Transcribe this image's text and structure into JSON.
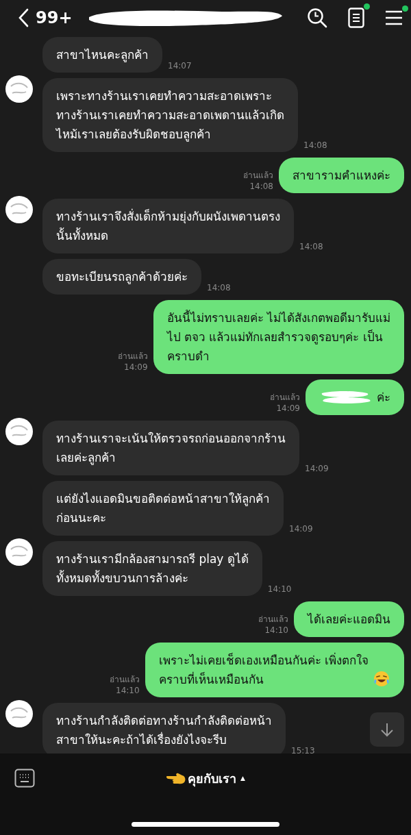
{
  "header": {
    "unread_count": "99+",
    "notes_badge": true,
    "menu_badge": true
  },
  "messages": [
    {
      "outgoing": false,
      "avatar": false,
      "kind": "text",
      "text": "สาขาไหนคะลูกค้า",
      "time": "14:07"
    },
    {
      "outgoing": false,
      "avatar": true,
      "kind": "text",
      "text": "เพราะทางร้านเราเคยทำความสะอาดเพราะ\nทางร้านเราเคยทำความสะอาดเพดานแล้วเกิด\nไหม้เราเลยต้องรับผิดชอบลูกค้า",
      "time": "14:08"
    },
    {
      "outgoing": true,
      "read": "อ่านแล้ว",
      "kind": "text",
      "text": "สาขารามคำแหงค่ะ",
      "time": "14:08"
    },
    {
      "outgoing": false,
      "avatar": true,
      "kind": "text",
      "text": "ทางร้านเราจึงสั่งเด็กห้ามยุ่งกับผนังเพดานตรง\nนั้นทั้งหมด",
      "time": "14:08"
    },
    {
      "outgoing": false,
      "avatar": false,
      "kind": "text",
      "text": "ขอทะเบียนรถลูกค้าด้วยค่ะ",
      "time": "14:08"
    },
    {
      "outgoing": true,
      "read": "อ่านแล้ว",
      "kind": "text",
      "text": "อันนี้ไม่ทราบเลยค่ะ ไม่ได้สังเกตพอดีมารับแม่\nไป ตจว แล้วแม่ทักเลยสำรวจดูรอบๆค่ะ เป็น\nคราบดำ",
      "time": "14:09"
    },
    {
      "outgoing": true,
      "read": "อ่านแล้ว",
      "kind": "redacted",
      "text": "ค่ะ",
      "time": "14:09"
    },
    {
      "outgoing": false,
      "avatar": true,
      "kind": "text",
      "text": "ทางร้านเราจะเน้นให้ตรวจรถก่อนออกจากร้าน\nเลยค่ะลูกค้า",
      "time": "14:09"
    },
    {
      "outgoing": false,
      "avatar": false,
      "kind": "text",
      "text": "แต่ยังไงแอดมินขอติดต่อหน้าสาขาให้ลูกค้า\nก่อนนะคะ",
      "time": "14:09"
    },
    {
      "outgoing": false,
      "avatar": true,
      "kind": "text",
      "text": "ทางร้านเรามีกล้องสามารถรี play ดูได้\nทั้งหมดทั้งขบวนการล้างค่ะ",
      "time": "14:10"
    },
    {
      "outgoing": true,
      "read": "อ่านแล้ว",
      "kind": "text",
      "text": "ได้เลยค่ะแอดมิน",
      "time": "14:10"
    },
    {
      "outgoing": true,
      "read": "อ่านแล้ว",
      "kind": "emoji",
      "text": "เพราะไม่เคยเช็ดเองเหมือนกันค่ะ เพิ่งตกใจ\nคราบที่เห็นเหมือนกัน",
      "time": "14:10"
    },
    {
      "outgoing": false,
      "avatar": true,
      "kind": "text",
      "text": "ทางร้านกำลังติดต่อทางร้านกำลังติดต่อหน้า\nสาขาให้นะคะถ้าได้เรื่องยังไงจะรีบ",
      "time": "15:13"
    }
  ],
  "bottom_bar": {
    "menu_label": "คุยกับเรา",
    "menu_caret": "▲"
  }
}
